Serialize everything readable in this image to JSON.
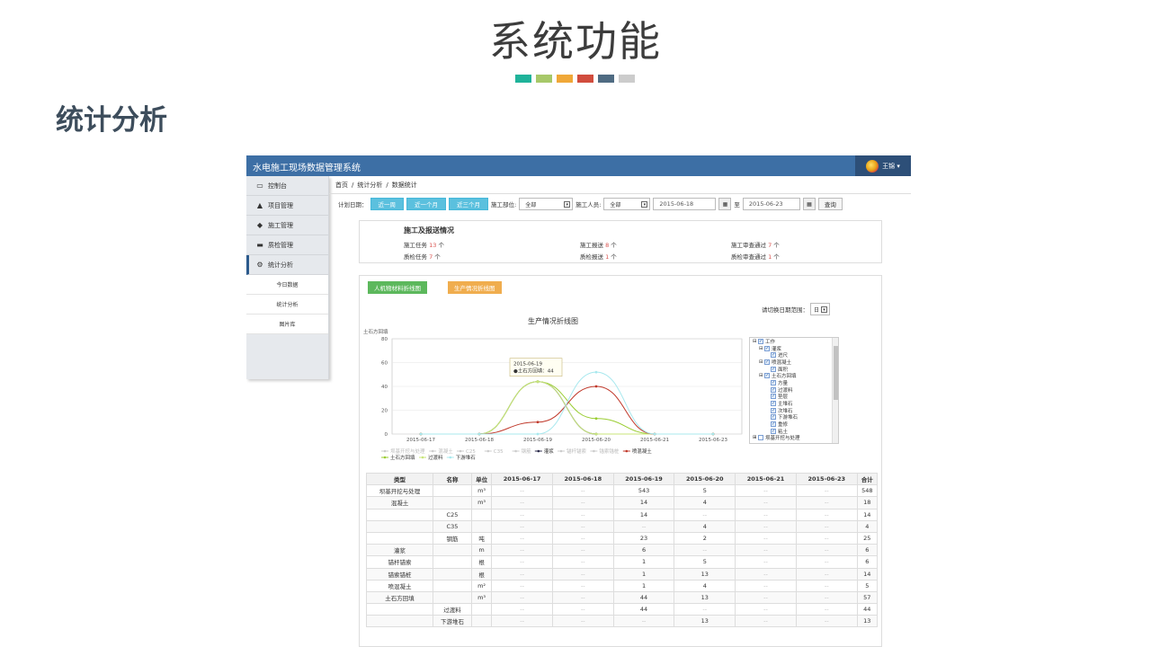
{
  "slide": {
    "title": "系统功能",
    "section": "统计分析",
    "colors": [
      "#1fb39a",
      "#a7c869",
      "#f0a838",
      "#d14c3d",
      "#4f6b82",
      "#cccccc"
    ]
  },
  "app": {
    "title": "水电施工现场数据管理系统",
    "user": "王锦 ▾"
  },
  "sidebar": {
    "items": [
      {
        "icon": "▭",
        "label": "控制台",
        "name": "sidebar-item-dashboard"
      },
      {
        "icon": "▲",
        "label": "项目管理",
        "name": "sidebar-item-projects"
      },
      {
        "icon": "◆",
        "label": "施工管理",
        "name": "sidebar-item-construction"
      },
      {
        "icon": "▬",
        "label": "质检管理",
        "name": "sidebar-item-inspection"
      },
      {
        "icon": "⚙",
        "label": "统计分析",
        "name": "sidebar-item-statistics"
      }
    ],
    "subitems": [
      "今日数据",
      "统计分析",
      "图片库"
    ]
  },
  "breadcrumb": [
    "首页",
    "/",
    "统计分析",
    "/",
    "数据统计"
  ],
  "filters": {
    "plan_date_label": "计划日期：",
    "range_buttons": [
      "近一周",
      "近一个月",
      "近三个月"
    ],
    "part_label": "施工部位:",
    "part_value": "全部",
    "person_label": "施工人员:",
    "person_value": "全部",
    "date_from": "2015-06-18",
    "to_label": "至",
    "date_to": "2015-06-23",
    "query": "查询"
  },
  "summary": {
    "title": "施工及报送情况",
    "cells": [
      {
        "pre": "施工任务",
        "num": "13",
        "post": "个"
      },
      {
        "pre": "施工报送",
        "num": "8",
        "post": "个"
      },
      {
        "pre": "施工审查通过",
        "num": "7",
        "post": "个"
      },
      {
        "pre": "质检任务",
        "num": "7",
        "post": "个"
      },
      {
        "pre": "质检报送",
        "num": "1",
        "post": "个"
      },
      {
        "pre": "质检审查通过",
        "num": "1",
        "post": "个"
      }
    ]
  },
  "panel": {
    "btn_machine": "人机物材料折线图",
    "btn_production": "生产情况折线图",
    "range_label": "请切换日期范围：",
    "range_value": "日"
  },
  "tree": [
    {
      "indent": 0,
      "exp": "⊟",
      "checked": true,
      "label": "工作"
    },
    {
      "indent": 1,
      "exp": "⊟",
      "checked": true,
      "label": "灌浆"
    },
    {
      "indent": 2,
      "exp": "",
      "checked": true,
      "label": "进尺"
    },
    {
      "indent": 1,
      "exp": "⊟",
      "checked": true,
      "label": "喷混凝土"
    },
    {
      "indent": 2,
      "exp": "",
      "checked": true,
      "label": "面积"
    },
    {
      "indent": 1,
      "exp": "⊟",
      "checked": true,
      "label": "土石方回填"
    },
    {
      "indent": 2,
      "exp": "",
      "checked": true,
      "label": "方量"
    },
    {
      "indent": 2,
      "exp": "",
      "checked": true,
      "label": "过渡料"
    },
    {
      "indent": 2,
      "exp": "",
      "checked": true,
      "label": "垫层"
    },
    {
      "indent": 2,
      "exp": "",
      "checked": true,
      "label": "主堆石"
    },
    {
      "indent": 2,
      "exp": "",
      "checked": true,
      "label": "次堆石"
    },
    {
      "indent": 2,
      "exp": "",
      "checked": true,
      "label": "下游堆石"
    },
    {
      "indent": 2,
      "exp": "",
      "checked": true,
      "label": "重修"
    },
    {
      "indent": 2,
      "exp": "",
      "checked": true,
      "label": "粘土"
    },
    {
      "indent": 0,
      "exp": "⊞",
      "checked": false,
      "label": "坝基开挖与处理"
    }
  ],
  "chart_data": {
    "type": "line",
    "title": "生产情况折线图",
    "ylabel": "土石方回填",
    "ylim": [
      0,
      80
    ],
    "yticks": [
      0,
      20,
      40,
      60,
      80
    ],
    "categories": [
      "2015-06-17",
      "2015-06-18",
      "2015-06-19",
      "2015-06-20",
      "2015-06-21",
      "2015-06-23"
    ],
    "series": [
      {
        "name": "灌浆",
        "color": "#2a2a4a",
        "values": [
          0,
          0,
          44,
          0,
          0,
          0
        ]
      },
      {
        "name": "土石方回填",
        "color": "#9acd32",
        "values": [
          0,
          0,
          44,
          13,
          0,
          0
        ]
      },
      {
        "name": "过渡料",
        "color": "#c8e67a",
        "values": [
          0,
          0,
          44,
          0,
          0,
          0
        ]
      },
      {
        "name": "喷混凝土",
        "color": "#c0392b",
        "values": [
          0,
          0,
          10,
          40,
          0,
          0
        ]
      },
      {
        "name": "下游堆石",
        "color": "#a8e8ee",
        "values": [
          0,
          0,
          0,
          52,
          0,
          0
        ]
      }
    ],
    "legend": [
      {
        "name": "坝基开挖与处理",
        "color": "#cccccc",
        "on": false
      },
      {
        "name": "混凝土",
        "color": "#cccccc",
        "on": false
      },
      {
        "name": "C25",
        "color": "#cccccc",
        "on": false
      },
      {
        "name": "C35",
        "color": "#cccccc",
        "on": false
      },
      {
        "name": "钢筋",
        "color": "#cccccc",
        "on": false
      },
      {
        "name": "灌浆",
        "color": "#2a2a4a",
        "on": true
      },
      {
        "name": "锚杆锚索",
        "color": "#cccccc",
        "on": false
      },
      {
        "name": "锚索锚桩",
        "color": "#cccccc",
        "on": false
      },
      {
        "name": "喷混凝土",
        "color": "#c0392b",
        "on": true
      },
      {
        "name": "土石方回填",
        "color": "#9acd32",
        "on": true
      },
      {
        "name": "过渡料",
        "color": "#c8e67a",
        "on": true
      },
      {
        "name": "下游堆石",
        "color": "#a8e8ee",
        "on": true
      }
    ],
    "tooltip": {
      "date": "2015-06-19",
      "text": "●土石方回填：44",
      "x_index": 2,
      "y": 44
    }
  },
  "table": {
    "headers": [
      "类型",
      "名称",
      "单位",
      "2015-06-17",
      "2015-06-18",
      "2015-06-19",
      "2015-06-20",
      "2015-06-21",
      "2015-06-23",
      "合计"
    ],
    "rows": [
      [
        "坝基开挖与处理",
        "",
        "m³",
        "--",
        "--",
        "543",
        "5",
        "--",
        "--",
        "548"
      ],
      [
        "混凝土",
        "",
        "m³",
        "--",
        "--",
        "14",
        "4",
        "--",
        "--",
        "18"
      ],
      [
        "",
        "C25",
        "",
        "--",
        "--",
        "14",
        "--",
        "--",
        "--",
        "14"
      ],
      [
        "",
        "C35",
        "",
        "--",
        "--",
        "--",
        "4",
        "--",
        "--",
        "4"
      ],
      [
        "",
        "钢筋",
        "吨",
        "--",
        "--",
        "23",
        "2",
        "--",
        "--",
        "25"
      ],
      [
        "灌浆",
        "",
        "m",
        "--",
        "--",
        "6",
        "--",
        "--",
        "--",
        "6"
      ],
      [
        "锚杆锚索",
        "",
        "根",
        "--",
        "--",
        "1",
        "5",
        "--",
        "--",
        "6"
      ],
      [
        "锚索锚桩",
        "",
        "根",
        "--",
        "--",
        "1",
        "13",
        "--",
        "--",
        "14"
      ],
      [
        "喷混凝土",
        "",
        "m²",
        "--",
        "--",
        "1",
        "4",
        "--",
        "--",
        "5"
      ],
      [
        "土石方回填",
        "",
        "m³",
        "--",
        "--",
        "44",
        "13",
        "--",
        "--",
        "57"
      ],
      [
        "",
        "过渡料",
        "",
        "--",
        "--",
        "44",
        "--",
        "--",
        "--",
        "44"
      ],
      [
        "",
        "下游堆石",
        "",
        "--",
        "--",
        "--",
        "13",
        "--",
        "--",
        "13"
      ]
    ]
  }
}
